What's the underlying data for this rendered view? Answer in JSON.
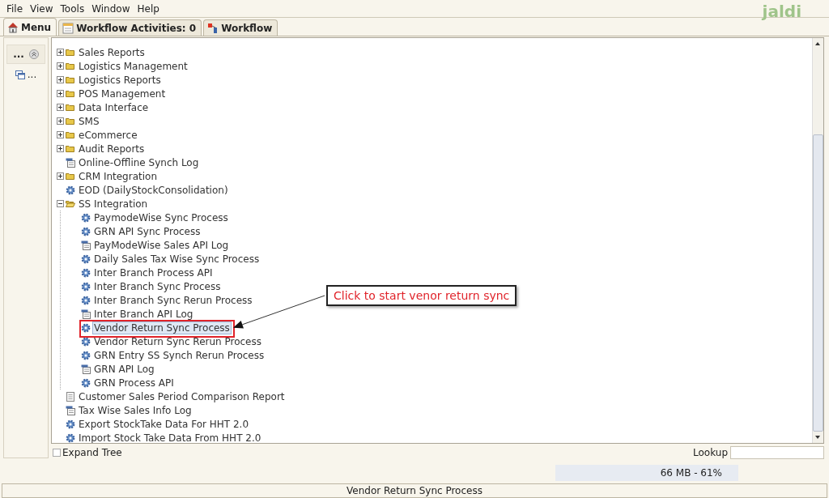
{
  "menu_bar": {
    "items": [
      "File",
      "View",
      "Tools",
      "Window",
      "Help"
    ]
  },
  "logo": {
    "text": "jaldi"
  },
  "tabs": [
    {
      "label": "Menu",
      "selected": true
    },
    {
      "label": "Workflow Activities: 0",
      "selected": false
    },
    {
      "label": "Workflow",
      "selected": false
    }
  ],
  "side_panel": {
    "header": "...",
    "items": [
      "..."
    ]
  },
  "tree": {
    "items": [
      {
        "label": "Sales Reports",
        "kind": "folder",
        "expanded": false,
        "selected": false
      },
      {
        "label": "Logistics Management",
        "kind": "folder",
        "expanded": false,
        "selected": false
      },
      {
        "label": "Logistics Reports",
        "kind": "folder",
        "expanded": false,
        "selected": false
      },
      {
        "label": "POS Management",
        "kind": "folder",
        "expanded": false,
        "selected": false
      },
      {
        "label": "Data Interface",
        "kind": "folder",
        "expanded": false,
        "selected": false
      },
      {
        "label": "SMS",
        "kind": "folder",
        "expanded": false,
        "selected": false
      },
      {
        "label": "eCommerce",
        "kind": "folder",
        "expanded": false,
        "selected": false
      },
      {
        "label": "Audit Reports",
        "kind": "folder",
        "expanded": false,
        "selected": false
      },
      {
        "label": "Online-Offline Synch Log",
        "kind": "log",
        "selected": false
      },
      {
        "label": "CRM Integration",
        "kind": "folder",
        "expanded": false,
        "selected": false
      },
      {
        "label": "EOD (DailyStockConsolidation)",
        "kind": "process",
        "selected": false
      },
      {
        "label": "SS Integration",
        "kind": "folder",
        "expanded": true,
        "selected": false,
        "children": [
          {
            "label": "PaymodeWise Sync Process",
            "kind": "process",
            "selected": false
          },
          {
            "label": "GRN API Sync Process",
            "kind": "process",
            "selected": false
          },
          {
            "label": "PayModeWise Sales API Log",
            "kind": "log",
            "selected": false
          },
          {
            "label": "Daily Sales Tax Wise Sync Process",
            "kind": "process",
            "selected": false
          },
          {
            "label": "Inter Branch Process API",
            "kind": "process",
            "selected": false
          },
          {
            "label": "Inter Branch Sync Process",
            "kind": "process",
            "selected": false
          },
          {
            "label": "Inter Branch Sync Rerun Process",
            "kind": "process",
            "selected": false
          },
          {
            "label": "Inter Branch API Log",
            "kind": "log",
            "selected": false
          },
          {
            "label": "Vendor Return Sync Process",
            "kind": "process",
            "selected": true
          },
          {
            "label": "Vendor Return Sync Rerun Process",
            "kind": "process",
            "selected": false
          },
          {
            "label": "GRN Entry SS Synch Rerun Process",
            "kind": "process",
            "selected": false
          },
          {
            "label": "GRN API Log",
            "kind": "log",
            "selected": false
          },
          {
            "label": "GRN Process API",
            "kind": "process",
            "selected": false
          }
        ]
      },
      {
        "label": "Customer Sales Period Comparison Report",
        "kind": "report",
        "selected": false
      },
      {
        "label": "Tax Wise Sales Info Log",
        "kind": "log",
        "selected": false
      },
      {
        "label": "Export StockTake Data For HHT 2.0",
        "kind": "process",
        "selected": false
      },
      {
        "label": "Import Stock Take Data From HHT 2.0",
        "kind": "process",
        "selected": false
      }
    ]
  },
  "expand_tree": {
    "label": "Expand Tree",
    "checked": false
  },
  "lookup": {
    "label": "Lookup"
  },
  "memory": {
    "text": "66 MB - 61%"
  },
  "status_bar": {
    "text": "Vendor Return Sync Process"
  },
  "annotation": {
    "text": "Click to start venor return sync"
  }
}
